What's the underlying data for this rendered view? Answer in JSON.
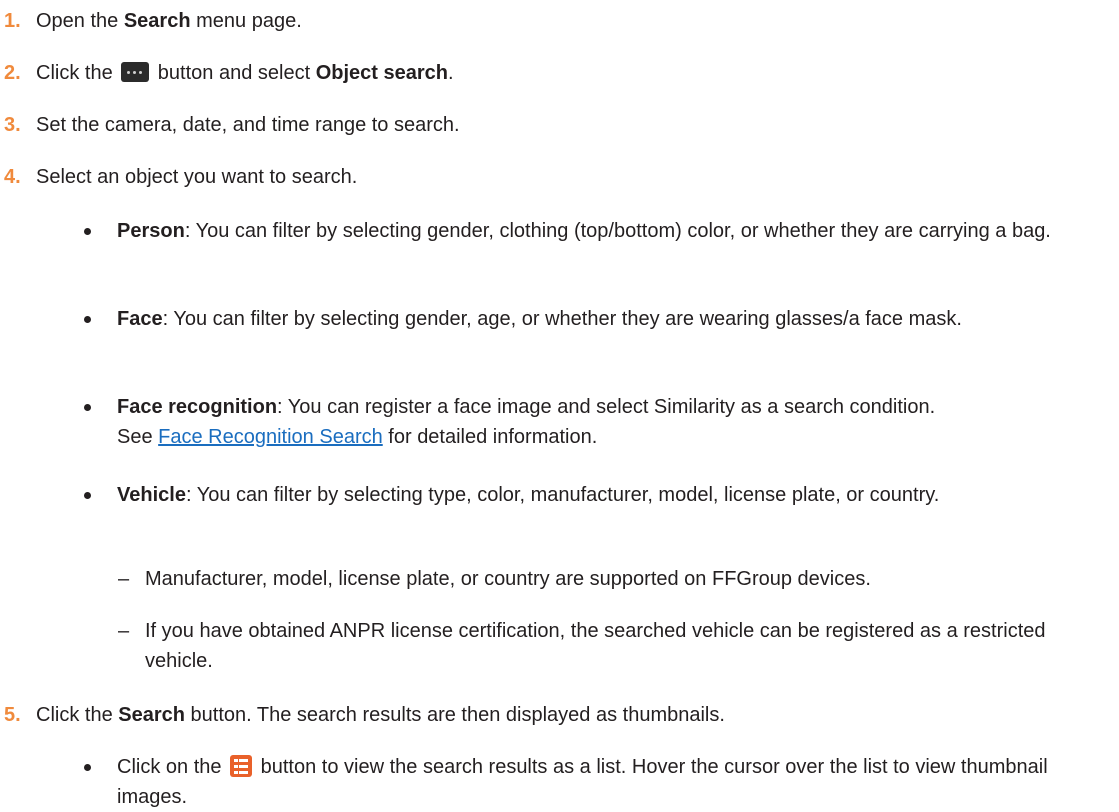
{
  "steps": [
    {
      "num": "1.",
      "pre": "Open the ",
      "bold": "Search",
      "post": " menu page."
    },
    {
      "num": "2.",
      "pre": "Click the ",
      "pre_icon": "more-icon",
      "mid": " button and select ",
      "bold": "Object search",
      "post": "."
    },
    {
      "num": "3.",
      "text": "Set the camera, date, and time range to search."
    },
    {
      "num": "4.",
      "text": "Select an object you want to search."
    },
    {
      "num": "5.",
      "pre": "Click the ",
      "bold": "Search",
      "post": " button. The search results are then displayed as thumbnails."
    }
  ],
  "objects": [
    {
      "term": "Person",
      "desc": ": You can filter by selecting gender, clothing (top/bottom) color, or whether they are carrying a bag."
    },
    {
      "term": "Face",
      "desc": ": You can filter by selecting gender, age, or whether they are wearing glasses/a face mask."
    },
    {
      "term": "Face recognition",
      "desc": ": You can register a face image and select Similarity as a search condition.",
      "see_pre": "See ",
      "link": "Face Recognition Search",
      "see_post": " for detailed information."
    },
    {
      "term": "Vehicle",
      "desc": ": You can filter by selecting type, color, manufacturer, model, license plate, or country."
    }
  ],
  "vehicle_notes": [
    "Manufacturer, model, license plate, or country are supported on FFGroup devices.",
    "If you have obtained ANPR license certification, the searched vehicle can be registered as a restricted vehicle."
  ],
  "results_note": {
    "pre": "Click on the ",
    "icon": "list-view-icon",
    "post": " button to view the search results as a list. Hover the cursor over the list to view thumbnail images."
  },
  "dash_char": "–",
  "colors": {
    "step_number": "#f08a3c",
    "link": "#1a6dbf",
    "list_icon": "#e9612a",
    "more_icon": "#2b2b2b"
  }
}
